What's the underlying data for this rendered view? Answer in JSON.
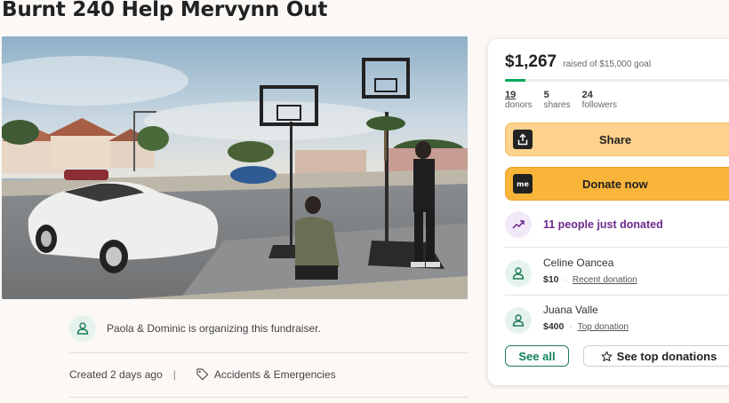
{
  "campaign": {
    "title": "Burnt 240 Help Mervynn Out",
    "organizer_text": "Paola & Dominic is organizing this fundraiser.",
    "created": "Created 2 days ago",
    "separator": "|",
    "category": "Accidents & Emergencies"
  },
  "donation_card": {
    "amount": "$1,267",
    "goal_text": "raised of $15,000 goal",
    "progress_fraction": 0.0845,
    "stats": [
      {
        "value": "19",
        "label": "donors"
      },
      {
        "value": "5",
        "label": "shares"
      },
      {
        "value": "24",
        "label": "followers"
      }
    ],
    "share_label": "Share",
    "donate_label": "Donate now",
    "donate_icon_text": "me",
    "trend_text": "11 people just donated",
    "donors": [
      {
        "name": "Celine Oancea",
        "amount": "$10",
        "dot": "·",
        "tag": "Recent donation"
      },
      {
        "name": "Juana Valle",
        "amount": "$400",
        "dot": "·",
        "tag": "Top donation"
      }
    ],
    "see_all_label": "See all",
    "see_top_label": "See top donations"
  },
  "icons": {
    "organizer": "person-icon",
    "category": "tag-icon",
    "share": "share-icon",
    "donate": "gofundme-icon",
    "trend": "trending-up-icon",
    "donor": "person-icon",
    "see_top": "star-icon"
  },
  "colors": {
    "brand_green": "#02a95c",
    "share_button": "#fcd28c",
    "donate_button": "#f9b53a",
    "trend_purple": "#6c2a8d"
  }
}
